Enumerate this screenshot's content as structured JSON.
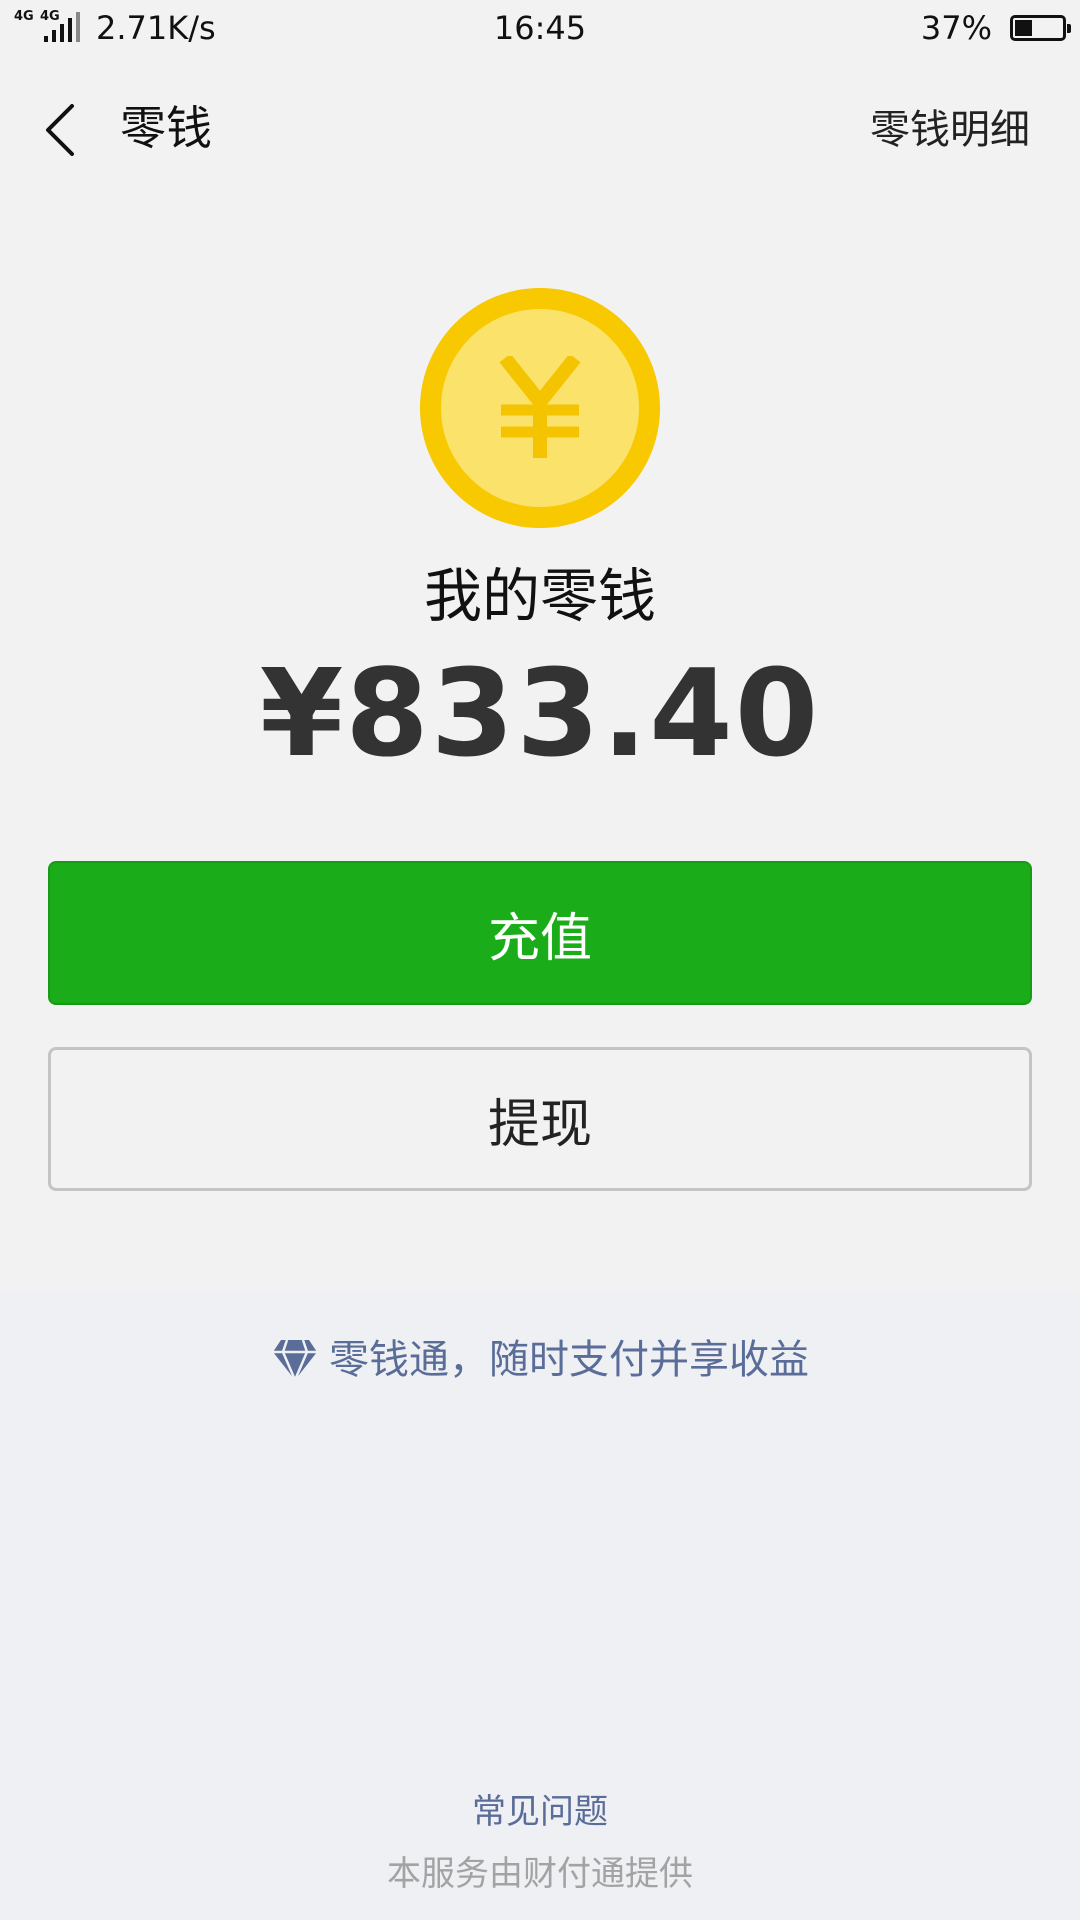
{
  "status_bar": {
    "network_label_1": "4G",
    "network_label_2": "4G",
    "net_speed": "2.71K/s",
    "time": "16:45",
    "battery_percent": "37%",
    "battery_level": 0.37
  },
  "header": {
    "back_icon": "chevron-left-icon",
    "title": "零钱",
    "detail_link": "零钱明细"
  },
  "balance": {
    "coin_icon": "yuan-coin-icon",
    "label": "我的零钱",
    "amount": "¥833.40"
  },
  "actions": {
    "recharge_label": "充值",
    "withdraw_label": "提现"
  },
  "promo": {
    "icon": "diamond-icon",
    "text": "零钱通，随时支付并享收益"
  },
  "footer": {
    "faq_label": "常见问题",
    "provider_text": "本服务由财付通提供"
  },
  "colors": {
    "primary_green": "#1aad19",
    "coin_outer": "#f8c800",
    "coin_inner": "#fbe26a",
    "link_blue": "#5a6d99"
  }
}
